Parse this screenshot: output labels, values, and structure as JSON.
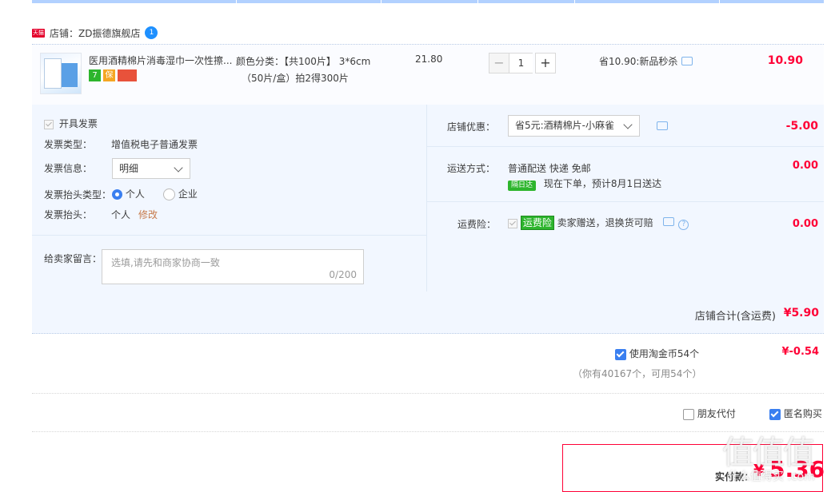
{
  "shop": {
    "badge": "天猫",
    "label": "店铺：ZD振德旗舰店",
    "chat_badge": "1"
  },
  "item": {
    "title": "医用酒精棉片消毒湿巾一次性擦...",
    "services": [
      {
        "icon": "seven-day-return-icon",
        "text": "7"
      },
      {
        "icon": "guarantee-icon",
        "text": "保"
      },
      {
        "icon": "credit-card-icon",
        "text": ""
      }
    ],
    "sku_line1": "颜色分类：【共100片】 3*6cm",
    "sku_line2": "（50片/盒）拍2得300片",
    "unit_price": "21.80",
    "quantity": "1",
    "minus": "−",
    "plus": "+",
    "saving": "省10.90:新品秒杀",
    "total": "10.90"
  },
  "invoice": {
    "checkbox_label": "开具发票",
    "type_label": "发票类型：",
    "type_value": "增值税电子普通发票",
    "info_label": "发票信息：",
    "info_value": "明细",
    "header_type_label": "发票抬头类型：",
    "option_personal": "个人",
    "option_company": "企业",
    "header_label": "发票抬头：",
    "header_value": "个人",
    "edit_link": "修改"
  },
  "message": {
    "label": "给卖家留言：",
    "placeholder": "选填,请先和商家协商一致",
    "counter": "0/200"
  },
  "coupon": {
    "label": "店铺优惠：",
    "value": "省5元:酒精棉片-小麻雀",
    "amount": "-5.00"
  },
  "shipping": {
    "label": "运送方式：",
    "line1": "普通配送 快递 免邮",
    "badge": "隔日达",
    "line2": "现在下单，预计8月1日送达",
    "amount": "0.00"
  },
  "insurance": {
    "label": "运费险：",
    "tag": "运费险",
    "text": "卖家赠送，退换货可赔",
    "amount": "0.00"
  },
  "shop_total": {
    "label": "店铺合计(含运费)",
    "amount": "¥5.90"
  },
  "coins": {
    "label": "使用淘金币54个",
    "amount": "¥-0.54",
    "note": "（你有40167个，可用54个）"
  },
  "options": {
    "friend_pay": "朋友代付",
    "anonymous": "匿名购买"
  },
  "payment": {
    "label": "实付款：",
    "currency": "¥",
    "amount": "5.36"
  },
  "watermark": {
    "text": "值值值",
    "sub": "什么值得买 .com"
  }
}
